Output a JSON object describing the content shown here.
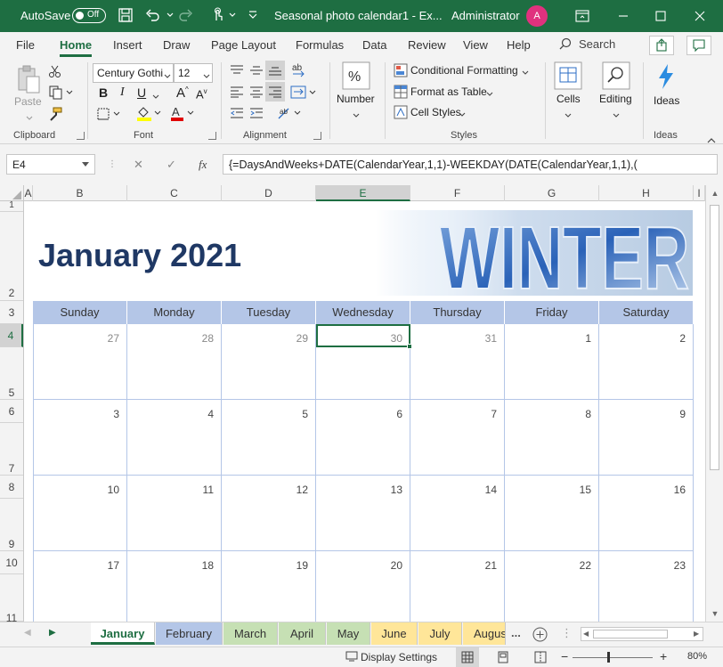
{
  "titlebar": {
    "autosave_label": "AutoSave",
    "autosave_state": "Off",
    "document_title": "Seasonal photo calendar1  -  Ex...",
    "user_name": "Administrator",
    "avatar_initial": "A",
    "background_color": "#1e6e42"
  },
  "menu": {
    "tabs": [
      "File",
      "Home",
      "Insert",
      "Draw",
      "Page Layout",
      "Formulas",
      "Data",
      "Review",
      "View",
      "Help"
    ],
    "active_tab": "Home",
    "search_label": "Search"
  },
  "ribbon": {
    "clipboard": {
      "paste_label": "Paste",
      "group_label": "Clipboard"
    },
    "font": {
      "font_name": "Century Gothi",
      "font_size": "12",
      "group_label": "Font"
    },
    "alignment": {
      "group_label": "Alignment"
    },
    "number": {
      "button_label": "Number"
    },
    "styles": {
      "conditional_formatting": "Conditional Formatting",
      "format_as_table": "Format as Table",
      "cell_styles": "Cell Styles",
      "group_label": "Styles"
    },
    "cells": {
      "button_label": "Cells"
    },
    "editing": {
      "button_label": "Editing"
    },
    "ideas": {
      "button_label": "Ideas",
      "group_label": "Ideas"
    }
  },
  "formula_bar": {
    "name_box": "E4",
    "fx_label": "fx",
    "formula": "{=DaysAndWeeks+DATE(CalendarYear,1,1)-WEEKDAY(DATE(CalendarYear,1,1),("
  },
  "grid": {
    "column_headers": [
      "A",
      "B",
      "C",
      "D",
      "E",
      "F",
      "G",
      "H",
      "I"
    ],
    "selected_column": "E",
    "row_headers": [
      "1",
      "2",
      "3",
      "4",
      "5",
      "6",
      "7",
      "8",
      "9",
      "10",
      "11"
    ],
    "selected_row": "4"
  },
  "calendar": {
    "title": "January 2021",
    "banner_text": "WINTER",
    "day_headers": [
      "Sunday",
      "Monday",
      "Tuesday",
      "Wednesday",
      "Thursday",
      "Friday",
      "Saturday"
    ],
    "weeks": [
      [
        "27",
        "28",
        "29",
        "30",
        "31",
        "1",
        "2"
      ],
      [
        "3",
        "4",
        "5",
        "6",
        "7",
        "8",
        "9"
      ],
      [
        "10",
        "11",
        "12",
        "13",
        "14",
        "15",
        "16"
      ],
      [
        "17",
        "18",
        "19",
        "20",
        "21",
        "22",
        "23"
      ]
    ],
    "header_color": "#b4c6e7",
    "title_color": "#1f3864"
  },
  "sheet_tabs": {
    "tabs": [
      {
        "label": "January",
        "color": "#ffffff"
      },
      {
        "label": "February",
        "color": "#b4c6e7"
      },
      {
        "label": "March",
        "color": "#c6e0b4"
      },
      {
        "label": "April",
        "color": "#c6e0b4"
      },
      {
        "label": "May",
        "color": "#c6e0b4"
      },
      {
        "label": "June",
        "color": "#ffe699"
      },
      {
        "label": "July",
        "color": "#ffe699"
      },
      {
        "label": "Augus",
        "color": "#ffe699"
      }
    ],
    "more_label": "..."
  },
  "statusbar": {
    "display_settings": "Display Settings",
    "zoom_level": "80%",
    "zoom_minus": "−",
    "zoom_plus": "+"
  }
}
